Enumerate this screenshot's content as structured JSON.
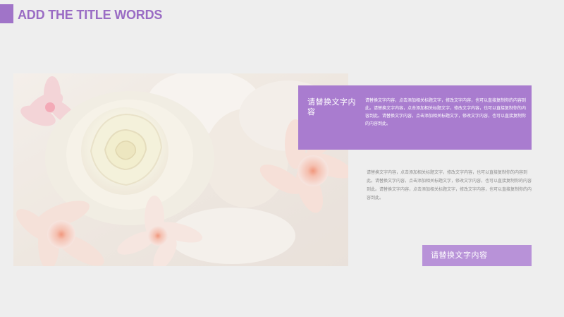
{
  "slide": {
    "title": "ADD THE TITLE WORDS"
  },
  "card": {
    "heading": "请替换文字内容",
    "body": "请替换文字内容，点击添加相关标题文字，修改文字内容，也可以直接复制你的内容到此。请替换文字内容，点击添加相关标题文字，修改文字内容，也可以直接复制你的内容到此。请替换文字内容，点击添加相关标题文字，修改文字内容，也可以直接复制你的内容到此。"
  },
  "body_text": "请替换文字内容，点击添加相关标题文字，修改文字内容，也可以直接复制你的内容到此。请替换文字内容，点击添加相关标题文字，修改文字内容，也可以直接复制你的内容到此。请替换文字内容，点击添加相关标题文字，修改文字内容，也可以直接复制你的内容到此。",
  "button_label": "请替换文字内容",
  "colors": {
    "accent": "#a074c8",
    "card": "#a97ccf",
    "button": "#b892d8",
    "background": "#eeeeee"
  }
}
